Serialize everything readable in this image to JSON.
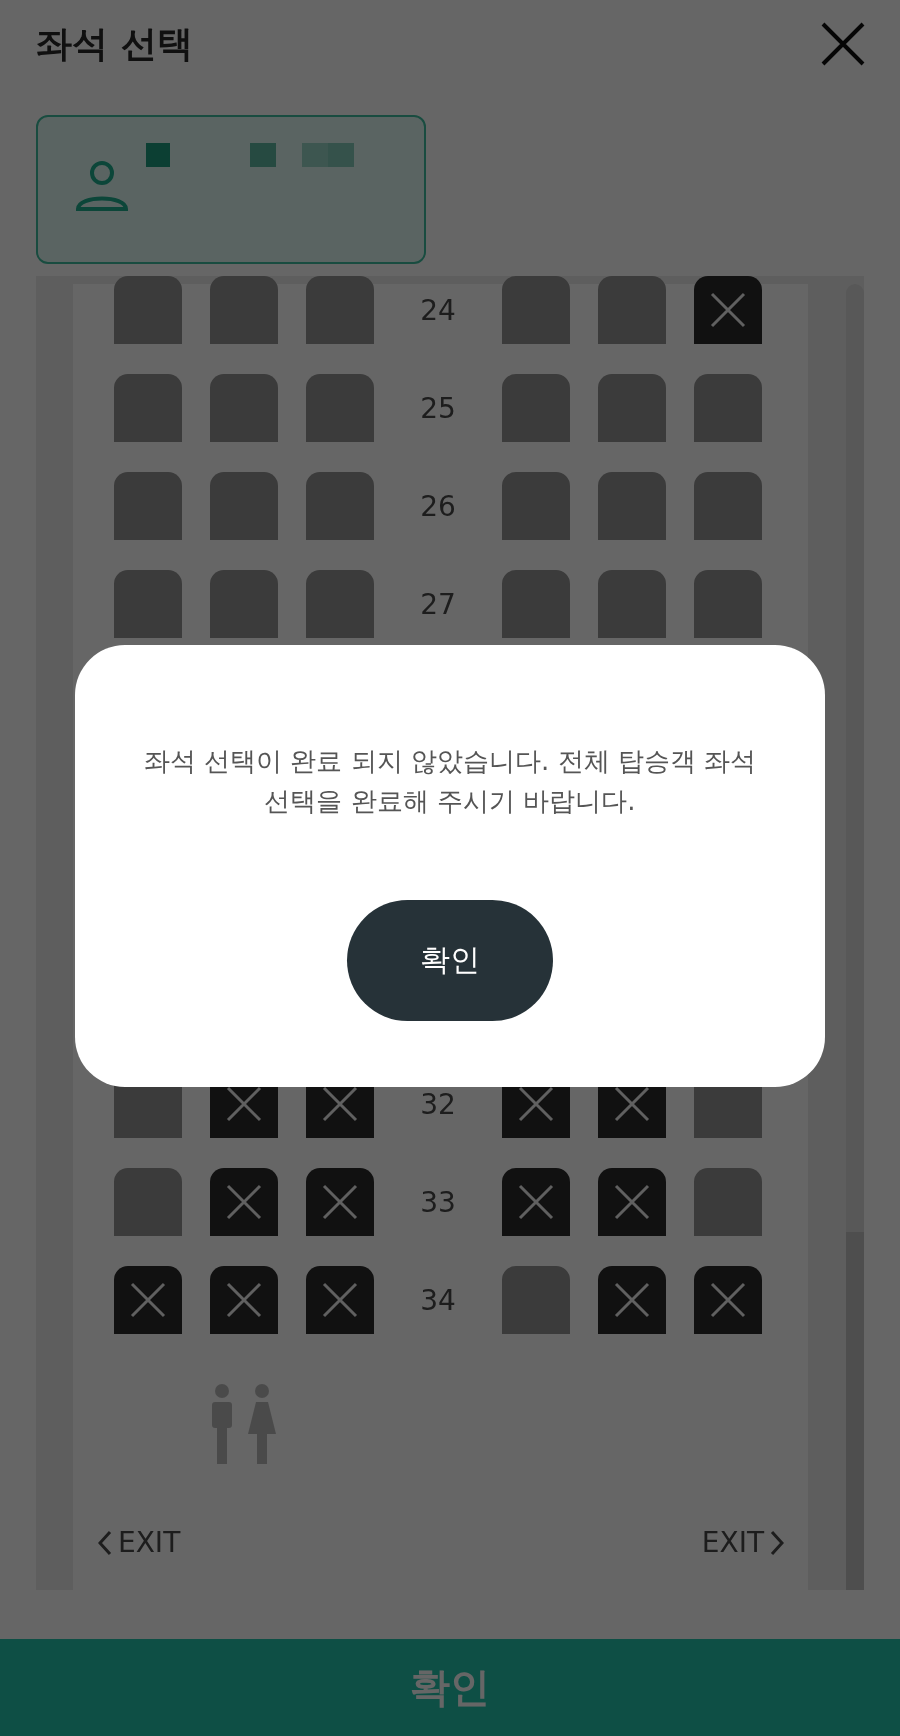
{
  "header": {
    "title": "좌석 선택"
  },
  "seat_map": {
    "rows": [
      {
        "number": "24",
        "seats": [
          {
            "taken": false
          },
          {
            "taken": false
          },
          {
            "taken": false
          },
          {
            "taken": false
          },
          {
            "taken": false
          },
          {
            "taken": true
          }
        ]
      },
      {
        "number": "25",
        "seats": [
          {
            "taken": false
          },
          {
            "taken": false
          },
          {
            "taken": false
          },
          {
            "taken": false
          },
          {
            "taken": false
          },
          {
            "taken": false
          }
        ]
      },
      {
        "number": "26",
        "seats": [
          {
            "taken": false
          },
          {
            "taken": false
          },
          {
            "taken": false
          },
          {
            "taken": false
          },
          {
            "taken": false
          },
          {
            "taken": false
          }
        ]
      },
      {
        "number": "27",
        "seats": [
          {
            "taken": false
          },
          {
            "taken": false
          },
          {
            "taken": false
          },
          {
            "taken": false
          },
          {
            "taken": false
          },
          {
            "taken": false
          }
        ]
      },
      {
        "number": "32",
        "seats": [
          {
            "taken": false
          },
          {
            "taken": true
          },
          {
            "taken": true
          },
          {
            "taken": true
          },
          {
            "taken": true
          },
          {
            "taken": false
          }
        ]
      },
      {
        "number": "33",
        "seats": [
          {
            "taken": false
          },
          {
            "taken": true
          },
          {
            "taken": true
          },
          {
            "taken": true
          },
          {
            "taken": true
          },
          {
            "taken": false
          }
        ]
      },
      {
        "number": "34",
        "seats": [
          {
            "taken": true
          },
          {
            "taken": true
          },
          {
            "taken": true
          },
          {
            "taken": false
          },
          {
            "taken": true
          },
          {
            "taken": true
          }
        ]
      }
    ],
    "exits": [
      {
        "label": "EXIT"
      },
      {
        "label": "EXIT"
      }
    ]
  },
  "dialog": {
    "message": "좌석 선택이 완료 되지 않았습니다. 전체 탑승객 좌석 선택을 완료해 주시기 바랍니다.",
    "button": "확인"
  },
  "bottom_button": {
    "label": "확인"
  }
}
